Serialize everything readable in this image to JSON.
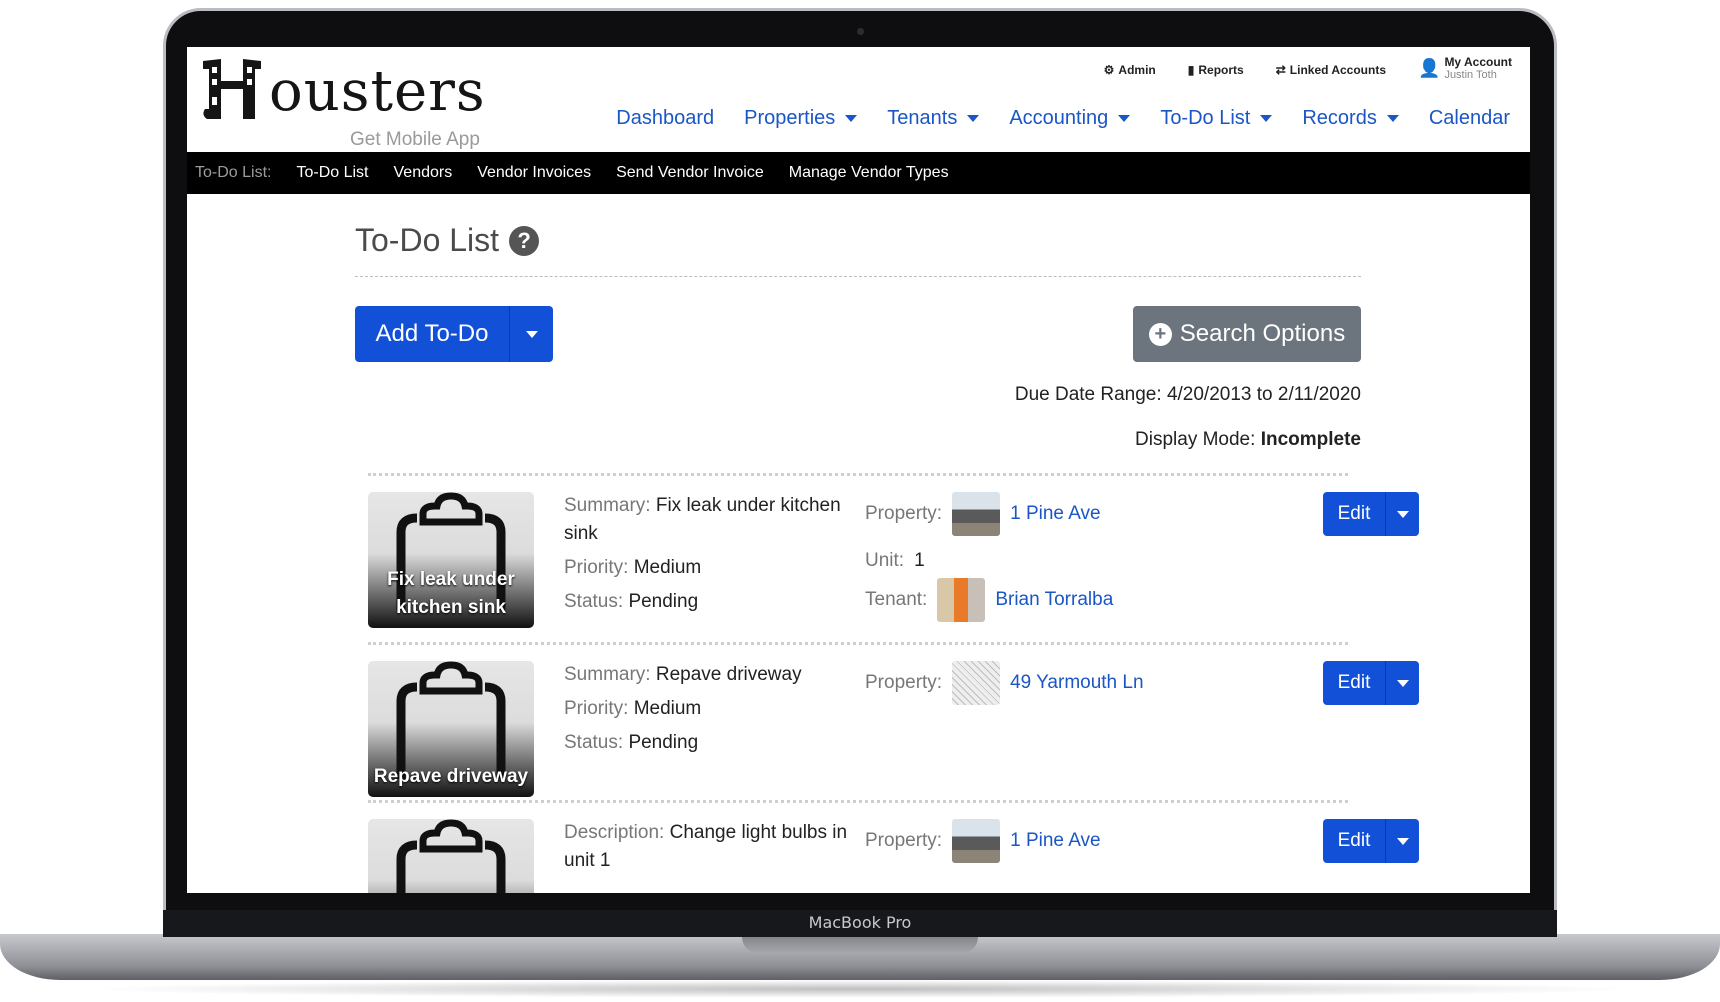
{
  "app": {
    "logo_text": "ousters",
    "logo_tagline": "Get Mobile App",
    "device_label": "MacBook Pro"
  },
  "topnav": {
    "admin": "Admin",
    "reports": "Reports",
    "linked": "Linked Accounts",
    "account": "My Account",
    "account_user": "Justin Toth"
  },
  "mainnav": [
    "Dashboard",
    "Properties",
    "Tenants",
    "Accounting",
    "To-Do List",
    "Records",
    "Calendar"
  ],
  "subnav": {
    "label": "To-Do List:",
    "items": [
      "To-Do List",
      "Vendors",
      "Vendor Invoices",
      "Send Vendor Invoice",
      "Manage Vendor Types"
    ]
  },
  "page": {
    "title": "To-Do List",
    "add_button": "Add To-Do",
    "search_button": "Search Options",
    "due_range_label": "Due Date Range:",
    "due_range_value": "4/20/2013 to 2/11/2020",
    "display_mode_label": "Display Mode:",
    "display_mode_value": "Incomplete"
  },
  "labels": {
    "summary": "Summary:",
    "description": "Description:",
    "priority": "Priority:",
    "status": "Status:",
    "property": "Property:",
    "unit": "Unit:",
    "tenant": "Tenant:",
    "edit": "Edit"
  },
  "todos": [
    {
      "caption": "Fix leak under kitchen sink",
      "summary": "Fix leak under kitchen sink",
      "priority": "Medium",
      "status": "Pending",
      "property": "1 Pine Ave",
      "unit": "1",
      "tenant": "Brian Torralba"
    },
    {
      "caption": "Repave driveway",
      "summary": "Repave driveway",
      "priority": "Medium",
      "status": "Pending",
      "property": "49 Yarmouth Ln"
    },
    {
      "description": "Change light bulbs in unit 1",
      "property": "1 Pine Ave"
    }
  ],
  "colors": {
    "primary": "#1150d7",
    "link": "#1a56c6",
    "secondary": "#6c757d"
  }
}
